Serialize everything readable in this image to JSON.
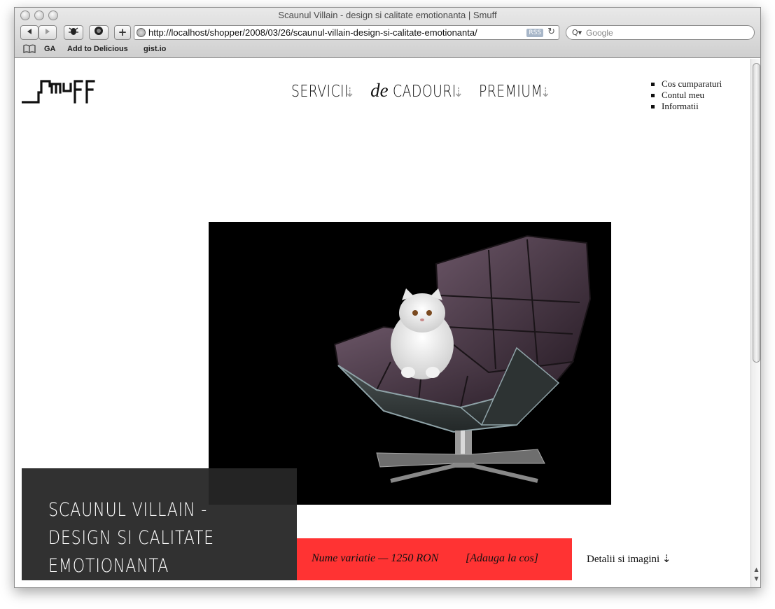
{
  "window": {
    "title": "Scaunul Villain - design si calitate emotionanta | Smuff"
  },
  "toolbar": {
    "back_icon": "back-arrow-icon",
    "forward_icon": "forward-arrow-icon",
    "add_label": "+",
    "url": "http://localhost/shopper/2008/03/26/scaunul-villain-design-si-calitate-emotionanta/",
    "rss_label": "RSS",
    "reload_symbol": "↻",
    "search_placeholder": "Google",
    "search_symbol": "Q▾"
  },
  "bookmarks": {
    "items": [
      {
        "label": "GA"
      },
      {
        "label": "Add to Delicious"
      },
      {
        "label": "gist.io"
      }
    ]
  },
  "page": {
    "nav": {
      "servicii": "SERVICII",
      "de": "de",
      "cadouri": "CADOURI",
      "premium": "PREMIUM",
      "arrow": "⇣"
    },
    "side_links": [
      {
        "label": "Cos cumparaturi"
      },
      {
        "label": "Contul meu"
      },
      {
        "label": "Informatii"
      }
    ],
    "product": {
      "title": "SCAUNUL VILLAIN - DESIGN SI CALITATE EMOTIONANTA",
      "variation": "Nume variatie — 1250 RON",
      "add_to_cart": "[Adauga la cos]",
      "details": "Detalii si imagini ⇣"
    }
  },
  "colors": {
    "buy_bar": "#ff3333",
    "caption_bg": "#262626"
  }
}
